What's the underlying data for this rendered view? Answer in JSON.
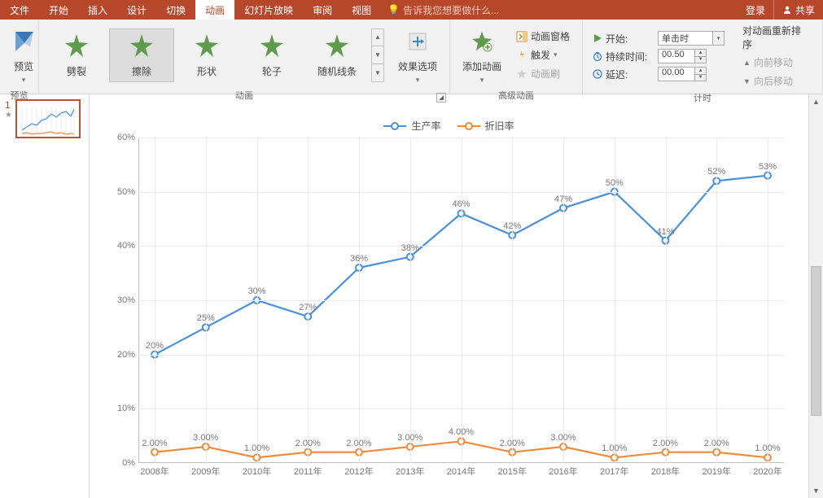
{
  "tabs": {
    "file": "文件",
    "home": "开始",
    "insert": "插入",
    "design": "设计",
    "transitions": "切换",
    "animations": "动画",
    "slideshow": "幻灯片放映",
    "review": "审阅",
    "view": "视图",
    "tellme": "告诉我您想要做什么...",
    "login": "登录",
    "share": "共享"
  },
  "ribbon": {
    "preview_group": "预览",
    "preview": "预览",
    "anim_group": "动画",
    "effects": {
      "split": "劈裂",
      "wipe": "擦除",
      "shape": "形状",
      "wheel": "轮子",
      "randombars": "随机线条"
    },
    "effect_options": "效果选项",
    "advanced_group": "高级动画",
    "add_anim": "添加动画",
    "anim_pane": "动画窗格",
    "trigger": "触发",
    "painter": "动画刷",
    "timing_group": "计时",
    "start_label": "开始:",
    "start_value": "单击时",
    "duration_label": "持续时间:",
    "duration_value": "00.50",
    "delay_label": "延迟:",
    "delay_value": "00.00",
    "reorder_title": "对动画重新排序",
    "move_earlier": "向前移动",
    "move_later": "向后移动"
  },
  "slide": {
    "number": "1"
  },
  "chart_data": {
    "type": "line",
    "categories": [
      "2008年",
      "2009年",
      "2010年",
      "2011年",
      "2012年",
      "2013年",
      "2014年",
      "2015年",
      "2016年",
      "2017年",
      "2018年",
      "2019年",
      "2020年"
    ],
    "series": [
      {
        "name": "生产率",
        "color": "#4a90d9",
        "values": [
          20,
          25,
          30,
          27,
          36,
          38,
          46,
          42,
          47,
          50,
          41,
          52,
          53
        ],
        "labels": [
          "20%",
          "25%",
          "30%",
          "27%",
          "36%",
          "38%",
          "46%",
          "42%",
          "47%",
          "50%",
          "41%",
          "52%",
          "53%"
        ]
      },
      {
        "name": "折旧率",
        "color": "#ed8b3b",
        "values": [
          2,
          3,
          1,
          2,
          2,
          3,
          4,
          2,
          3,
          1,
          2,
          2,
          1
        ],
        "labels": [
          "2.00%",
          "3.00%",
          "1.00%",
          "2.00%",
          "2.00%",
          "3.00%",
          "4.00%",
          "2.00%",
          "3.00%",
          "1.00%",
          "2.00%",
          "2.00%",
          "1.00%"
        ]
      }
    ],
    "ymax": 60,
    "ymin": 0,
    "ystep": 10,
    "ytick_labels": [
      "0%",
      "10%",
      "20%",
      "30%",
      "40%",
      "50%",
      "60%"
    ]
  }
}
